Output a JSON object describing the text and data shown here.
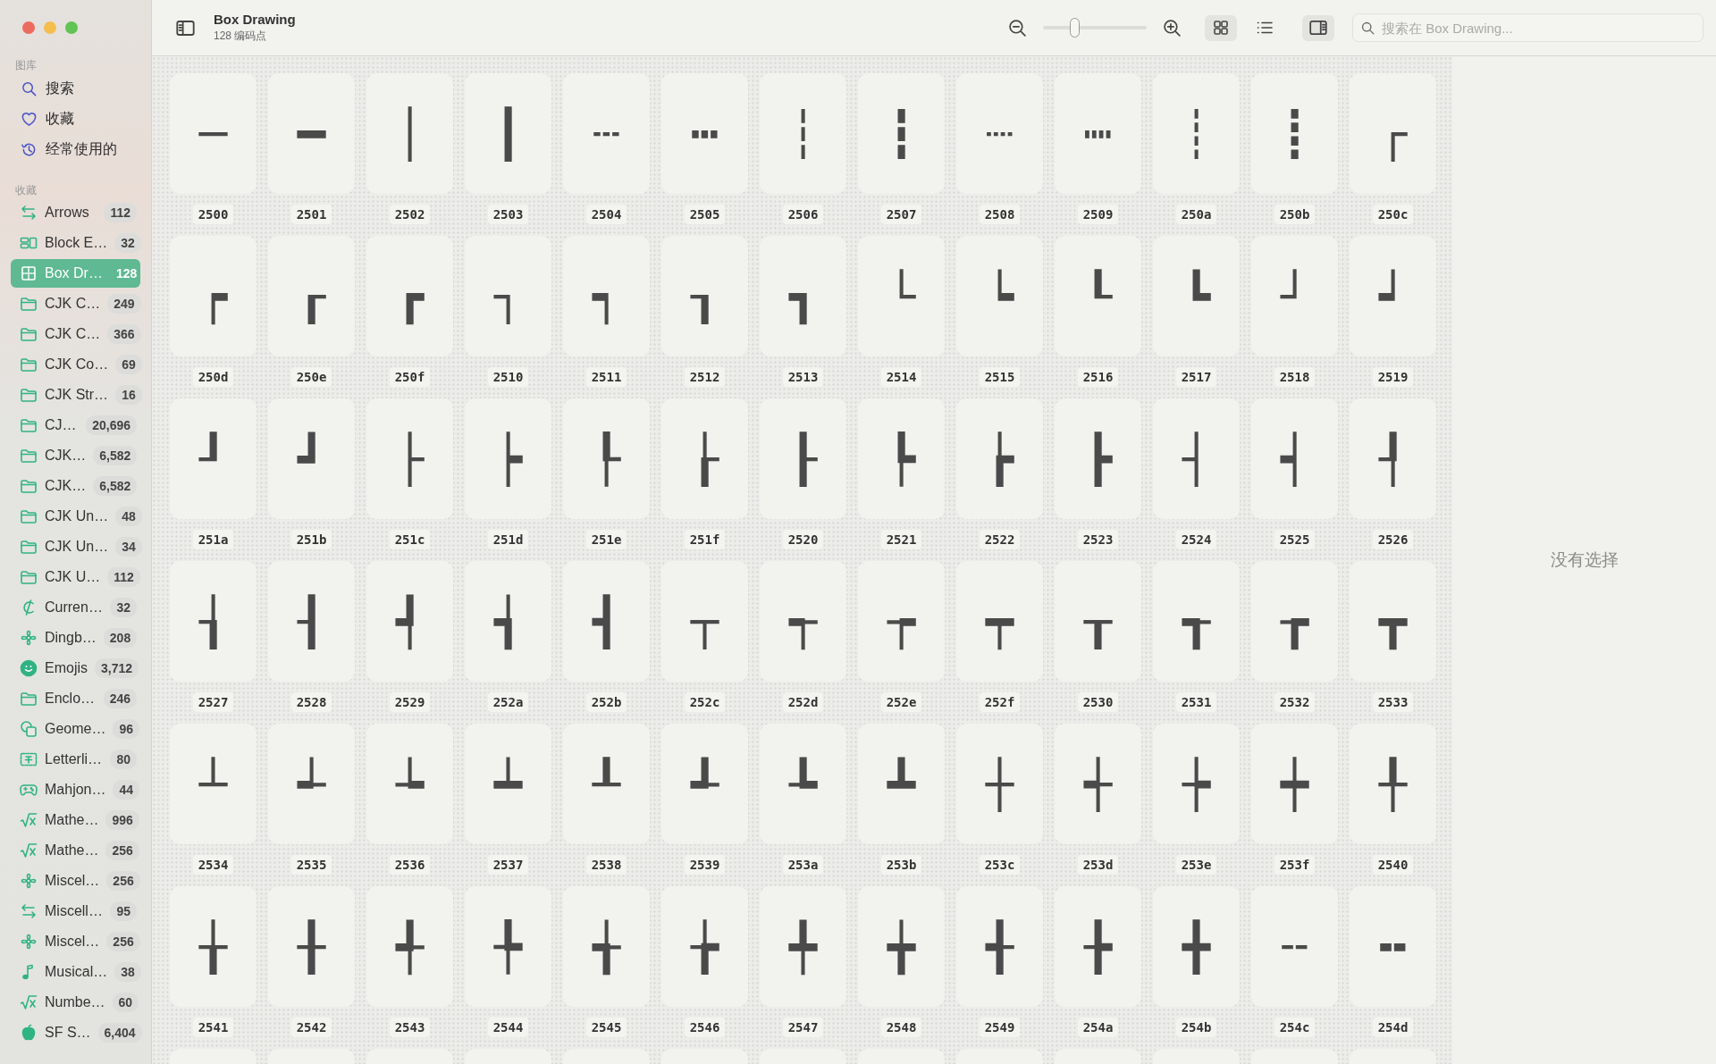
{
  "toolbar": {
    "title": "Box Drawing",
    "subtitle": "128 编码点",
    "zoom": {
      "level": 0.3
    },
    "views": [
      {
        "selected": true
      },
      {
        "selected": false
      }
    ],
    "inspector_toggle": {
      "selected": true
    },
    "search": {
      "placeholder": "搜索在 Box Drawing..."
    }
  },
  "sidebar": {
    "library_title": "图库",
    "library": [
      {
        "label": "搜索"
      },
      {
        "label": "收藏"
      },
      {
        "label": "经常使用的"
      }
    ],
    "collections_title": "收藏",
    "collections": [
      {
        "label": "Arrows",
        "count": "112",
        "selected": false
      },
      {
        "label": "Block E…",
        "count": "32",
        "selected": false
      },
      {
        "label": "Box Dr…",
        "count": "128",
        "selected": true
      },
      {
        "label": "CJK C…",
        "count": "249",
        "selected": false
      },
      {
        "label": "CJK C…",
        "count": "366",
        "selected": false
      },
      {
        "label": "CJK Co…",
        "count": "69",
        "selected": false
      },
      {
        "label": "CJK Str…",
        "count": "16",
        "selected": false
      },
      {
        "label": "CJ…",
        "count": "20,696",
        "selected": false
      },
      {
        "label": "CJK…",
        "count": "6,582",
        "selected": false
      },
      {
        "label": "CJK…",
        "count": "6,582",
        "selected": false
      },
      {
        "label": "CJK Un…",
        "count": "48",
        "selected": false
      },
      {
        "label": "CJK Un…",
        "count": "34",
        "selected": false
      },
      {
        "label": "CJK U…",
        "count": "112",
        "selected": false
      },
      {
        "label": "Curren…",
        "count": "32",
        "selected": false
      },
      {
        "label": "Dingb…",
        "count": "208",
        "selected": false
      },
      {
        "label": "Emojis",
        "count": "3,712",
        "selected": false
      },
      {
        "label": "Enclo…",
        "count": "246",
        "selected": false
      },
      {
        "label": "Geome…",
        "count": "96",
        "selected": false
      },
      {
        "label": "Letterli…",
        "count": "80",
        "selected": false
      },
      {
        "label": "Mahjon…",
        "count": "44",
        "selected": false
      },
      {
        "label": "Mathe…",
        "count": "996",
        "selected": false
      },
      {
        "label": "Mathe…",
        "count": "256",
        "selected": false
      },
      {
        "label": "Miscel…",
        "count": "256",
        "selected": false
      },
      {
        "label": "Miscell…",
        "count": "95",
        "selected": false
      },
      {
        "label": "Miscel…",
        "count": "256",
        "selected": false
      },
      {
        "label": "Musical…",
        "count": "38",
        "selected": false
      },
      {
        "label": "Numbe…",
        "count": "60",
        "selected": false
      },
      {
        "label": "SF S…",
        "count": "6,404",
        "selected": false
      }
    ]
  },
  "glyphs": [
    {
      "glyph": "─",
      "code": "2500"
    },
    {
      "glyph": "━",
      "code": "2501"
    },
    {
      "glyph": "│",
      "code": "2502"
    },
    {
      "glyph": "┃",
      "code": "2503"
    },
    {
      "glyph": "┄",
      "code": "2504"
    },
    {
      "glyph": "┅",
      "code": "2505"
    },
    {
      "glyph": "┆",
      "code": "2506"
    },
    {
      "glyph": "┇",
      "code": "2507"
    },
    {
      "glyph": "┈",
      "code": "2508"
    },
    {
      "glyph": "┉",
      "code": "2509"
    },
    {
      "glyph": "┊",
      "code": "250a"
    },
    {
      "glyph": "┋",
      "code": "250b"
    },
    {
      "glyph": "┌",
      "code": "250c"
    },
    {
      "glyph": "┍",
      "code": "250d"
    },
    {
      "glyph": "┎",
      "code": "250e"
    },
    {
      "glyph": "┏",
      "code": "250f"
    },
    {
      "glyph": "┐",
      "code": "2510"
    },
    {
      "glyph": "┑",
      "code": "2511"
    },
    {
      "glyph": "┒",
      "code": "2512"
    },
    {
      "glyph": "┓",
      "code": "2513"
    },
    {
      "glyph": "└",
      "code": "2514"
    },
    {
      "glyph": "┕",
      "code": "2515"
    },
    {
      "glyph": "┖",
      "code": "2516"
    },
    {
      "glyph": "┗",
      "code": "2517"
    },
    {
      "glyph": "┘",
      "code": "2518"
    },
    {
      "glyph": "┙",
      "code": "2519"
    },
    {
      "glyph": "┚",
      "code": "251a"
    },
    {
      "glyph": "┛",
      "code": "251b"
    },
    {
      "glyph": "├",
      "code": "251c"
    },
    {
      "glyph": "┝",
      "code": "251d"
    },
    {
      "glyph": "┞",
      "code": "251e"
    },
    {
      "glyph": "┟",
      "code": "251f"
    },
    {
      "glyph": "┠",
      "code": "2520"
    },
    {
      "glyph": "┡",
      "code": "2521"
    },
    {
      "glyph": "┢",
      "code": "2522"
    },
    {
      "glyph": "┣",
      "code": "2523"
    },
    {
      "glyph": "┤",
      "code": "2524"
    },
    {
      "glyph": "┥",
      "code": "2525"
    },
    {
      "glyph": "┦",
      "code": "2526"
    },
    {
      "glyph": "┧",
      "code": "2527"
    },
    {
      "glyph": "┨",
      "code": "2528"
    },
    {
      "glyph": "┩",
      "code": "2529"
    },
    {
      "glyph": "┪",
      "code": "252a"
    },
    {
      "glyph": "┫",
      "code": "252b"
    },
    {
      "glyph": "┬",
      "code": "252c"
    },
    {
      "glyph": "┭",
      "code": "252d"
    },
    {
      "glyph": "┮",
      "code": "252e"
    },
    {
      "glyph": "┯",
      "code": "252f"
    },
    {
      "glyph": "┰",
      "code": "2530"
    },
    {
      "glyph": "┱",
      "code": "2531"
    },
    {
      "glyph": "┲",
      "code": "2532"
    },
    {
      "glyph": "┳",
      "code": "2533"
    },
    {
      "glyph": "┴",
      "code": "2534"
    },
    {
      "glyph": "┵",
      "code": "2535"
    },
    {
      "glyph": "┶",
      "code": "2536"
    },
    {
      "glyph": "┷",
      "code": "2537"
    },
    {
      "glyph": "┸",
      "code": "2538"
    },
    {
      "glyph": "┹",
      "code": "2539"
    },
    {
      "glyph": "┺",
      "code": "253a"
    },
    {
      "glyph": "┻",
      "code": "253b"
    },
    {
      "glyph": "┼",
      "code": "253c"
    },
    {
      "glyph": "┽",
      "code": "253d"
    },
    {
      "glyph": "┾",
      "code": "253e"
    },
    {
      "glyph": "┿",
      "code": "253f"
    },
    {
      "glyph": "╀",
      "code": "2540"
    },
    {
      "glyph": "╁",
      "code": "2541"
    },
    {
      "glyph": "╂",
      "code": "2542"
    },
    {
      "glyph": "╃",
      "code": "2543"
    },
    {
      "glyph": "╄",
      "code": "2544"
    },
    {
      "glyph": "╅",
      "code": "2545"
    },
    {
      "glyph": "╆",
      "code": "2546"
    },
    {
      "glyph": "╇",
      "code": "2547"
    },
    {
      "glyph": "╈",
      "code": "2548"
    },
    {
      "glyph": "╉",
      "code": "2549"
    },
    {
      "glyph": "╊",
      "code": "254a"
    },
    {
      "glyph": "╋",
      "code": "254b"
    },
    {
      "glyph": "╌",
      "code": "254c"
    },
    {
      "glyph": "╍",
      "code": "254d"
    }
  ],
  "inspector": {
    "empty_text": "没有选择"
  }
}
